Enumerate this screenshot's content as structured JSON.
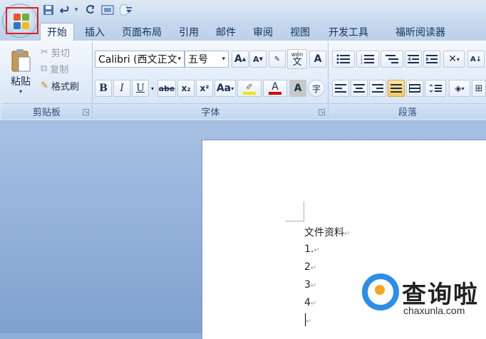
{
  "quick_access": {
    "save_icon": "save-icon",
    "undo_icon": "undo-icon",
    "redo_icon": "redo-icon",
    "print_preview_icon": "print-preview-icon",
    "customize_glyph": "₹"
  },
  "tabs": [
    {
      "label": "开始",
      "active": true
    },
    {
      "label": "插入"
    },
    {
      "label": "页面布局"
    },
    {
      "label": "引用"
    },
    {
      "label": "邮件"
    },
    {
      "label": "审阅"
    },
    {
      "label": "视图"
    },
    {
      "label": "开发工具"
    },
    {
      "label": "福昕阅读器"
    }
  ],
  "clipboard": {
    "group_label": "剪贴板",
    "paste": "粘贴",
    "cut": "剪切",
    "copy": "复制",
    "format_painter": "格式刷"
  },
  "font": {
    "group_label": "字体",
    "font_name": "Calibri (西文正文",
    "font_size": "五号",
    "grow": "A",
    "shrink": "A",
    "bold": "B",
    "italic": "I",
    "underline": "U",
    "strikethrough": "abe",
    "subscript": "x₂",
    "superscript": "x²",
    "change_case": "Aa",
    "font_color": "A",
    "char_shading": "A",
    "enclose_char": "字",
    "phonetic": "wén",
    "phonetic_char": "文"
  },
  "paragraph": {
    "group_label": "段落"
  },
  "document": {
    "lines": [
      "文件资料",
      "1.",
      "2",
      "3",
      "4"
    ],
    "para_mark": "↵"
  },
  "watermark": {
    "brand": "查询啦",
    "domain": "chaxunla.com"
  },
  "colors": {
    "highlight_box": "#e02020",
    "highlight_marker": "#f2e600",
    "font_color_bar": "#d40000",
    "watermark_blue": "#2b8ee8",
    "watermark_orange": "#f5a623"
  }
}
